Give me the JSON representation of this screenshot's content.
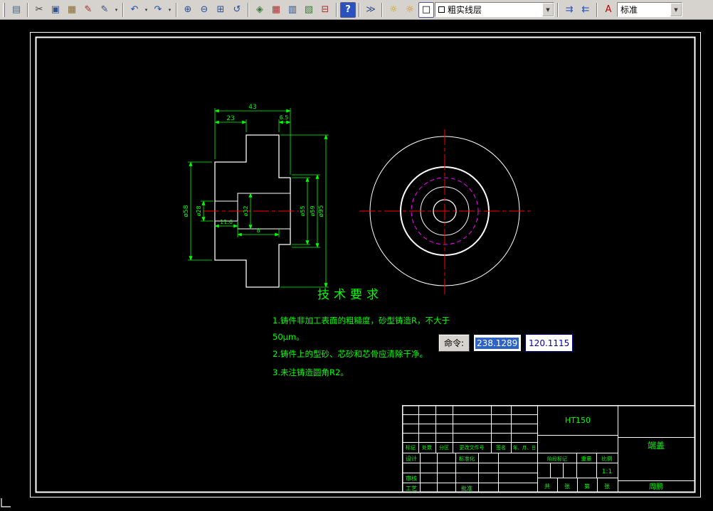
{
  "colors": {
    "toolbar_bg": "#d6d3ce",
    "canvas_bg": "#000000",
    "sheet_line": "#ffffff",
    "dim_green": "#00ff00",
    "centerline_red": "#ff0000",
    "hidden_magenta": "#ff00ff",
    "selection_blue": "#2f62c5",
    "field_text_blue": "#0000a8"
  },
  "toolbar": {
    "caret_glyph": "▾",
    "combo_arrow_glyph": "▼",
    "items": [
      {
        "type": "icon",
        "name": "sheet-set-icon",
        "glyph": "▤",
        "color": "#4a6b8a"
      },
      {
        "type": "sep"
      },
      {
        "type": "icon",
        "name": "cut-icon",
        "glyph": "✂",
        "color": "#404040"
      },
      {
        "type": "icon",
        "name": "copy-icon",
        "glyph": "▣",
        "color": "#33518a"
      },
      {
        "type": "icon",
        "name": "paste-icon",
        "glyph": "▦",
        "color": "#8a6b33"
      },
      {
        "type": "icon",
        "name": "format-painter-icon",
        "glyph": "✎",
        "color": "#a03030"
      },
      {
        "type": "icon",
        "name": "edit-properties-icon",
        "glyph": "✎",
        "color": "#33518a"
      },
      {
        "type": "caret",
        "name": "edit-properties-caret"
      },
      {
        "type": "sep"
      },
      {
        "type": "icon",
        "name": "undo-icon",
        "glyph": "↶",
        "color": "#2a4f9e"
      },
      {
        "type": "caret",
        "name": "undo-caret"
      },
      {
        "type": "icon",
        "name": "redo-icon",
        "glyph": "↷",
        "color": "#2a4f9e"
      },
      {
        "type": "caret",
        "name": "redo-caret"
      },
      {
        "type": "sep"
      },
      {
        "type": "icon",
        "name": "zoom-in-icon",
        "glyph": "⊕",
        "color": "#2a4f9e"
      },
      {
        "type": "icon",
        "name": "zoom-out-icon",
        "glyph": "⊖",
        "color": "#2a4f9e"
      },
      {
        "type": "icon",
        "name": "zoom-window-icon",
        "glyph": "⊞",
        "color": "#2a4f9e"
      },
      {
        "type": "icon",
        "name": "zoom-previous-icon",
        "glyph": "↺",
        "color": "#2a4f9e"
      },
      {
        "type": "sep"
      },
      {
        "type": "icon",
        "name": "pan-icon",
        "glyph": "◈",
        "color": "#3a7a3a"
      },
      {
        "type": "icon",
        "name": "grid-snap-icon",
        "glyph": "▦",
        "color": "#b03030"
      },
      {
        "type": "icon",
        "name": "frame-settings-icon",
        "glyph": "▥",
        "color": "#33518a"
      },
      {
        "type": "icon",
        "name": "raster-icon",
        "glyph": "▧",
        "color": "#3a7a3a"
      },
      {
        "type": "icon",
        "name": "display-window-icon",
        "glyph": "⊟",
        "color": "#a03030"
      },
      {
        "type": "sep"
      },
      {
        "type": "icon",
        "name": "help-icon",
        "glyph": "?",
        "color": "#ffffff",
        "bg": "#2a52be"
      },
      {
        "type": "sep"
      },
      {
        "type": "icon",
        "name": "more-tools-icon",
        "glyph": "≫",
        "color": "#33518a"
      },
      {
        "type": "sep"
      },
      {
        "type": "icon",
        "name": "layer-visibility-icon",
        "glyph": "☼",
        "color": "#c8a000"
      },
      {
        "type": "icon",
        "name": "layer-lock-icon",
        "glyph": "☼",
        "color": "#e08000"
      },
      {
        "type": "icon",
        "name": "layer-color-icon",
        "glyph": "□",
        "color": "#000000",
        "bg": "#ffffff"
      },
      {
        "type": "combo",
        "name": "layer-combo",
        "value": "粗实线层",
        "swatch": true,
        "width": 168
      },
      {
        "type": "sep"
      },
      {
        "type": "icon",
        "name": "move-to-layer-icon",
        "glyph": "⇉",
        "color": "#2a52be"
      },
      {
        "type": "icon",
        "name": "copy-layer-icon",
        "glyph": "⇇",
        "color": "#2a52be"
      },
      {
        "type": "sep"
      },
      {
        "type": "icon",
        "name": "text-style-icon",
        "glyph": "A",
        "color": "#c00000"
      },
      {
        "type": "combo",
        "name": "text-style-combo",
        "value": "标准",
        "swatch": false,
        "width": 92
      }
    ]
  },
  "command_overlay": {
    "label": "命令:",
    "value_x": "238.1289",
    "value_y": "120.1115"
  },
  "drawing": {
    "tech_req_title": "技术要求",
    "tech_req_lines": [
      "1.铸件非加工表面的粗糙度，砂型铸造R，不大于",
      "50μm。",
      "2.铸件上的型砂、芯砂和芯骨应清除干净。",
      "3.未注铸造圆角R2。"
    ],
    "dims": {
      "total_width": "43",
      "flange_offset": "23",
      "lip": "6.5",
      "boss_left": "ø58",
      "bore_small": "ø28",
      "bore_large": "ø32",
      "depth_small": "11.6",
      "depth_large": "8",
      "boss_right": "ø55",
      "spigot": "ø59",
      "flange_od": "ø95"
    }
  },
  "title_block": {
    "material": "HT150",
    "part_name": "端盖",
    "author": "周鹏",
    "scale_value": "1:1",
    "header_cells": [
      "标记",
      "处数",
      "分区",
      "更改文件号",
      "签名",
      "年、月、日"
    ],
    "row_labels": {
      "design": "设计",
      "standardization": "标准化",
      "review": "审核",
      "process": "工艺",
      "approve": "批准"
    },
    "info_labels": {
      "stage": "阶段标记",
      "weight": "重量",
      "scale": "比例"
    },
    "sheet_row": {
      "total": "共",
      "sheet1": "张",
      "page": "第",
      "sheet2": "张"
    }
  }
}
